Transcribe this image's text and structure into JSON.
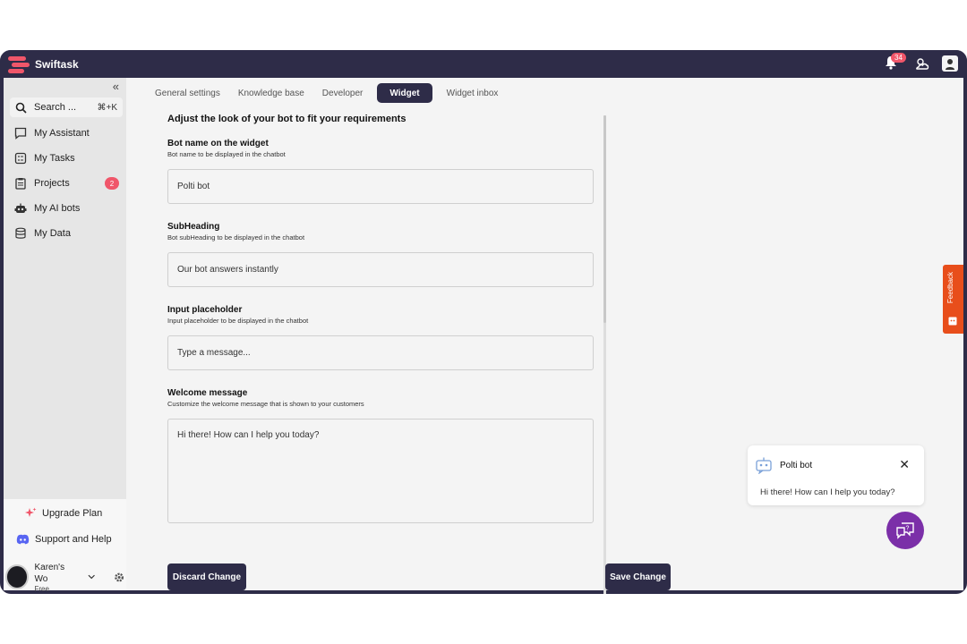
{
  "app": {
    "name": "Swiftask"
  },
  "topbar": {
    "notification_count": "34"
  },
  "sidebar": {
    "search_label": "Search ...",
    "search_shortcut": "⌘+K",
    "items": [
      {
        "label": "My Assistant",
        "icon": "chat-icon"
      },
      {
        "label": "My Tasks",
        "icon": "tasks-icon"
      },
      {
        "label": "Projects",
        "icon": "clipboard-icon",
        "badge": "2"
      },
      {
        "label": "My AI bots",
        "icon": "robot-icon"
      },
      {
        "label": "My Data",
        "icon": "database-icon"
      }
    ],
    "upgrade_label": "Upgrade Plan",
    "support_label": "Support and Help",
    "user_name": "Karen's Wo",
    "user_plan": "Free"
  },
  "tabs": [
    {
      "label": "General settings",
      "active": false
    },
    {
      "label": "Knowledge base",
      "active": false
    },
    {
      "label": "Developer",
      "active": false
    },
    {
      "label": "Widget",
      "active": true
    },
    {
      "label": "Widget inbox",
      "active": false
    }
  ],
  "form": {
    "title": "Adjust the look of your bot to fit your requirements",
    "bot_name": {
      "label": "Bot name on the widget",
      "help": "Bot name to be displayed in the chatbot",
      "value": "Polti bot"
    },
    "subheading": {
      "label": "SubHeading",
      "help": "Bot subHeading to be displayed in the chatbot",
      "value": "Our bot answers instantly"
    },
    "placeholder": {
      "label": "Input placeholder",
      "help": "Input placeholder to be displayed in the chatbot",
      "value": "Type a message..."
    },
    "welcome": {
      "label": "Welcome message",
      "help": "Customize the welcome message that is shown to your customers",
      "value": "Hi there! How can I help you today?"
    }
  },
  "actions": {
    "discard_label": "Discard Change",
    "save_label": "Save Change"
  },
  "preview": {
    "bot_name": "Polti bot",
    "message": "Hi there! How can I help you today?"
  },
  "feedback_label": "Feedback",
  "colors": {
    "brand_dark": "#2e2c48",
    "accent_red": "#f0566a",
    "fab_purple": "#7b2fa8",
    "feedback_orange": "#e84e1b"
  }
}
